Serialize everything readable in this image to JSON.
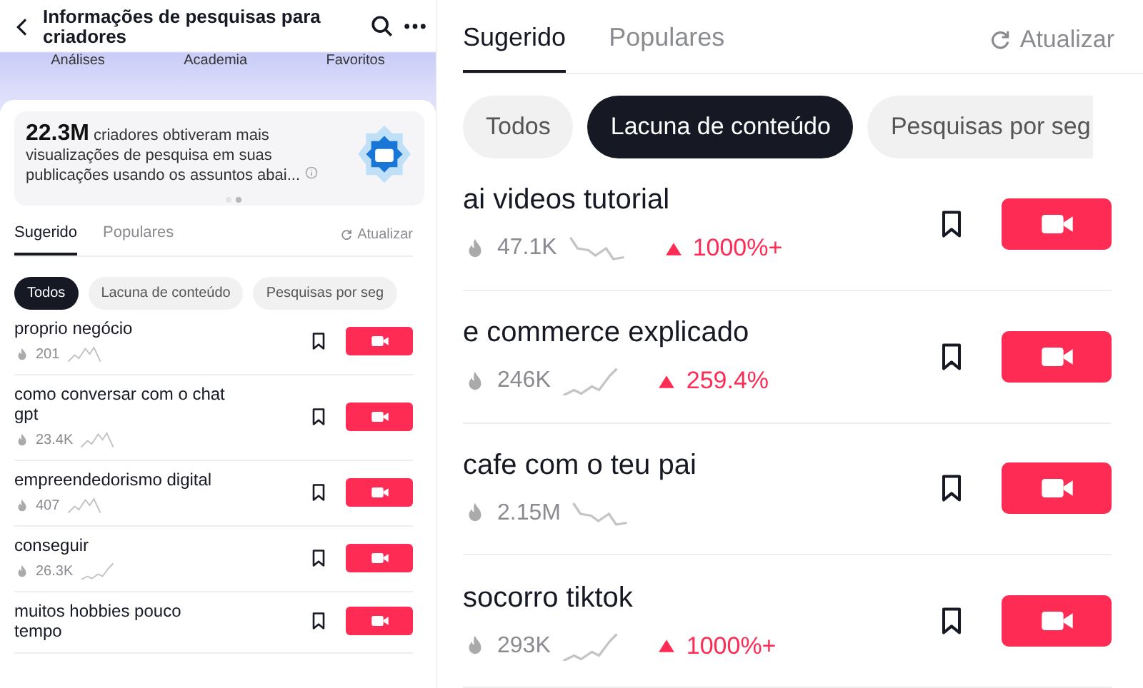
{
  "left": {
    "header": {
      "title": "Informações de pesquisas para criadores"
    },
    "nav": [
      {
        "label": "Análises"
      },
      {
        "label": "Academia"
      },
      {
        "label": "Favoritos"
      }
    ],
    "info": {
      "figure": "22.3M",
      "text": "criadores obtiveram mais visualizações de pesquisa em suas publicações usando os assuntos abai...",
      "pages": [
        {
          "selected": false
        },
        {
          "selected": true
        }
      ]
    },
    "tabs": [
      {
        "label": "Sugerido",
        "selected": true
      },
      {
        "label": "Populares",
        "selected": false
      }
    ],
    "refresh": "Atualizar",
    "chips": [
      {
        "label": "Todos",
        "selected": true
      },
      {
        "label": "Lacuna de conteúdo",
        "selected": false
      },
      {
        "label": "Pesquisas por seg",
        "selected": false
      }
    ],
    "rows": [
      {
        "title": "proprio negócio",
        "views": "201"
      },
      {
        "title": "como conversar com o chat gpt",
        "views": "23.4K"
      },
      {
        "title": "empreendedorismo digital",
        "views": "407"
      },
      {
        "title": "conseguir",
        "views": "26.3K"
      },
      {
        "title": "muitos hobbies pouco tempo"
      }
    ]
  },
  "right": {
    "tabs": [
      {
        "label": "Sugerido",
        "selected": true
      },
      {
        "label": "Populares",
        "selected": false
      }
    ],
    "refresh": "Atualizar",
    "chips": [
      {
        "label": "Todos",
        "selected": false
      },
      {
        "label": "Lacuna de conteúdo",
        "selected": true
      },
      {
        "label": "Pesquisas por seg",
        "selected": false
      }
    ],
    "rows": [
      {
        "title": "ai videos tutorial",
        "views": "47.1K",
        "growth": "1000%+"
      },
      {
        "title": "e commerce explicado",
        "views": "246K",
        "growth": "259.4%"
      },
      {
        "title": "cafe com o teu pai",
        "views": "2.15M"
      },
      {
        "title": "socorro tiktok",
        "views": "293K",
        "growth": "1000%+"
      }
    ]
  }
}
